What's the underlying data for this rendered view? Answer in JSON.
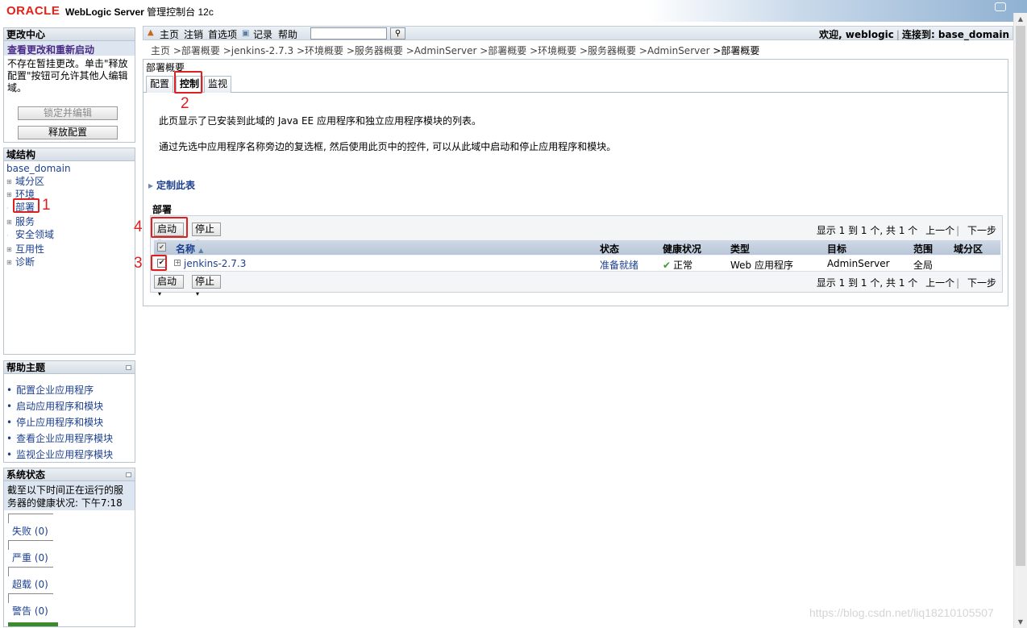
{
  "header": {
    "logo": "ORACLE",
    "product": "WebLogic Server",
    "title_suffix": "管理控制台 12c"
  },
  "change_center": {
    "title": "更改中心",
    "link": "查看更改和重新启动",
    "message": "不存在暂挂更改。单击\"释放配置\"按钮可允许其他人编辑域。",
    "lock_button": "锁定并编辑",
    "release_button": "释放配置"
  },
  "domain_structure": {
    "title": "域结构",
    "root": "base_domain",
    "items": [
      "域分区",
      "环境",
      "部署",
      "服务",
      "安全领域",
      "互用性",
      "诊断"
    ]
  },
  "help_topics": {
    "title": "帮助主题",
    "items": [
      "配置企业应用程序",
      "启动应用程序和模块",
      "停止应用程序和模块",
      "查看企业应用程序模块",
      "监视企业应用程序模块"
    ]
  },
  "system_status": {
    "title": "系统状态",
    "description": "截至以下时间正在运行的服务器的健康状况:  下午7:18",
    "rows": [
      "失败 (0)",
      "严重 (0)",
      "超载 (0)",
      "警告 (0)"
    ]
  },
  "topnav": {
    "home": "主页",
    "logout": "注销",
    "preferences": "首选项",
    "record": "记录",
    "help": "帮助",
    "search_value": "",
    "welcome": "欢迎, weblogic",
    "connected": "连接到: base_domain"
  },
  "breadcrumb": {
    "items": [
      "主页",
      ">部署概要",
      ">jenkins-2.7.3",
      ">环境概要",
      ">服务器概要",
      ">AdminServer",
      ">部署概要",
      ">环境概要",
      ">服务器概要",
      ">AdminServer"
    ],
    "current": ">部署概要"
  },
  "main": {
    "heading": "部署概要",
    "tabs": [
      "配置",
      "控制",
      "监视"
    ],
    "intro1": "此页显示了已安装到此域的 Java EE 应用程序和独立应用程序模块的列表。",
    "intro2": "通过先选中应用程序名称旁边的复选框, 然后使用此页中的控件, 可以从此域中启动和停止应用程序和模块。",
    "customize": "定制此表",
    "table_title": "部署",
    "start_button": "启动",
    "stop_button": "停止",
    "pager": {
      "info": "显示 1 到 1 个, 共 1 个",
      "prev": "上一个",
      "next": "下一步"
    },
    "columns": [
      "名称",
      "状态",
      "健康状况",
      "类型",
      "目标",
      "范围",
      "域分区"
    ],
    "rows": [
      {
        "checked": true,
        "name": "jenkins-2.7.3",
        "state": "准备就绪",
        "health": "正常",
        "type": "Web 应用程序",
        "target": "AdminServer",
        "scope": "全局",
        "partition": ""
      }
    ]
  },
  "annotations": [
    "1",
    "2",
    "3",
    "4"
  ],
  "watermark": "https://blog.csdn.net/liq18210105507",
  "colors": {
    "oracle_red": "#e2231a",
    "link_blue": "#1b3f8f",
    "annotation_red": "#e02020",
    "status_ok": "#3a9a2c"
  }
}
